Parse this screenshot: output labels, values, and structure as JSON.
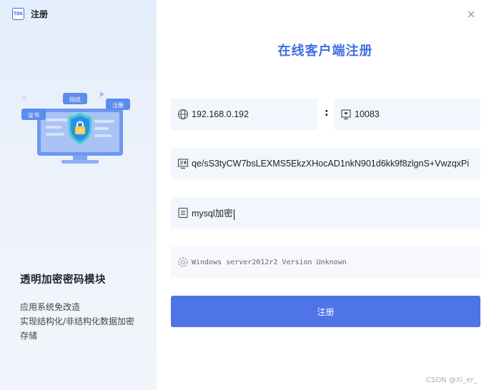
{
  "app": {
    "logo_text": "TDE",
    "title": "注册"
  },
  "illustration": {
    "tag_cert": "证书",
    "tag_fingerprint": "指纹",
    "tag_register": "注册"
  },
  "left": {
    "module_title": "透明加密密码模块",
    "desc_line1": "应用系统免改造",
    "desc_line2": "实现结构化/非结构化数据加密存储"
  },
  "form": {
    "title": "在线客户端注册",
    "ip": "192.168.0.192",
    "separator": ":",
    "port": "10083",
    "key": "qe/sS3tyCW7bsLEXMS5EkzXHocAD1nkN901d6kk9f8zlgnS+VwzqxPi",
    "name": "mysql加密",
    "os_info": "Windows server2012r2 Version Unknown",
    "submit_label": "注册"
  },
  "footer": {
    "watermark": "CSDN @Xi_er_"
  },
  "colors": {
    "accent": "#4f74e8",
    "title_blue": "#3f6fe0",
    "field_bg": "#f3f6fd"
  }
}
